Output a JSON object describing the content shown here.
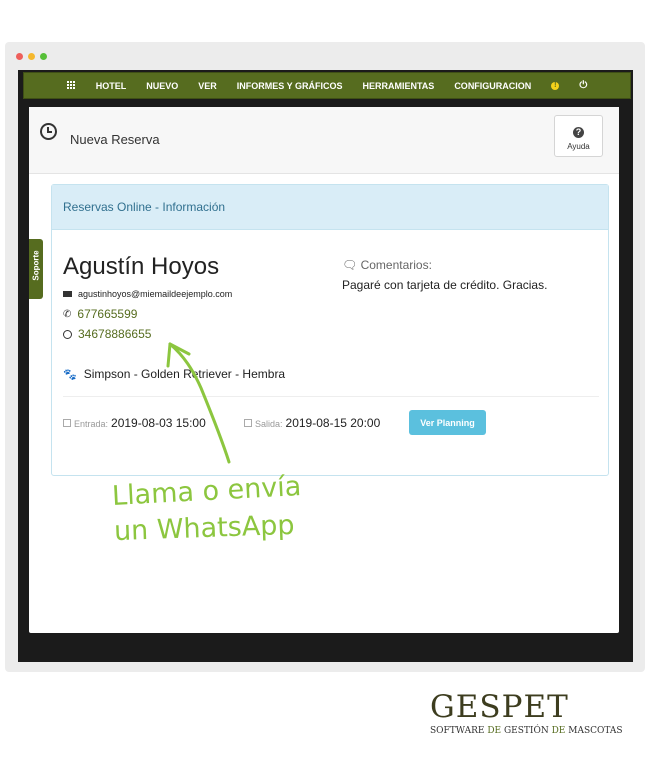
{
  "nav": {
    "items": [
      {
        "label": "HOTEL"
      },
      {
        "label": "NUEVO"
      },
      {
        "label": "VER"
      },
      {
        "label": "INFORMES Y GRÁFICOS"
      },
      {
        "label": "HERRAMIENTAS"
      },
      {
        "label": "CONFIGURACION"
      }
    ],
    "icons": {
      "grid": "grid-icon",
      "warning": "warning-icon",
      "power": "power-icon"
    }
  },
  "header": {
    "title": "Nueva Reserva",
    "help_label": "Ayuda"
  },
  "side_tab": {
    "label": "Soporte"
  },
  "card": {
    "title": "Reservas Online - Información",
    "client_name": "Agustín Hoyos",
    "email": "agustinhoyos@miemaildeejemplo.com",
    "phone": "677665599",
    "whatsapp": "34678886655",
    "pet": "Simpson - Golden Retriever - Hembra",
    "comments_label": "Comentarios:",
    "comments_text": "Pagaré con tarjeta de crédito. Gracias.",
    "entrada_label": "Entrada:",
    "entrada_value": "2019-08-03 15:00",
    "salida_label": "Salida:",
    "salida_value": "2019-08-15 20:00",
    "planning_button": "Ver Planning"
  },
  "annotation": {
    "line1": "Llama o envía",
    "line2": "un WhatsApp"
  },
  "logo": {
    "main": "GESPET",
    "sub_a": "SOFTWARE ",
    "sub_b": "DE",
    "sub_c": " GESTIÓN ",
    "sub_d": "DE",
    "sub_e": " MASCOTAS"
  },
  "colors": {
    "nav": "#566c1f",
    "accent_green": "#8cc63f",
    "info_blue": "#d9edf7",
    "button": "#5bc0de"
  }
}
